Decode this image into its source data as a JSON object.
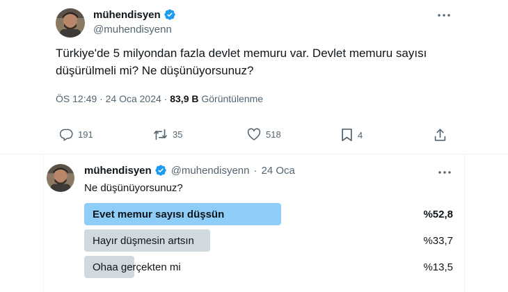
{
  "tweet": {
    "author": {
      "display_name": "mühendisyen",
      "handle": "@muhendisyenn",
      "verified": true
    },
    "text": "Türkiye'de 5 milyondan fazla devlet memuru var. Devlet memuru sayısı düşürülmeli mi? Ne düşünüyorsunuz?",
    "time": "ÖS 12:49",
    "date": "24 Oca 2024",
    "views_count": "83,9 B",
    "views_label": "Görüntülenme",
    "actions": {
      "replies": "191",
      "reposts": "35",
      "likes": "518",
      "bookmarks": "4"
    }
  },
  "quote": {
    "author": {
      "display_name": "mühendisyen",
      "handle": "@muhendisyenn",
      "verified": true
    },
    "date": "24 Oca",
    "text": "Ne düşünüyorsunuz?",
    "poll": {
      "options": [
        {
          "label": "Evet memur sayısı düşsün",
          "percent": "%52,8",
          "fraction": 0.528,
          "winner": true
        },
        {
          "label": "Hayır düşmesin artsın",
          "percent": "%33,7",
          "fraction": 0.337,
          "winner": false
        },
        {
          "label": "Ohaa gerçekten mi",
          "percent": "%13,5",
          "fraction": 0.135,
          "winner": false
        }
      ]
    }
  },
  "colors": {
    "verified": "#1d9bf0",
    "poll_winner": "#8ecdf8",
    "poll_other": "#cfd9de",
    "secondary_text": "#536471"
  },
  "icons": [
    "verified-badge-icon",
    "more-icon",
    "reply-icon",
    "repost-icon",
    "like-icon",
    "bookmark-icon",
    "share-icon"
  ]
}
